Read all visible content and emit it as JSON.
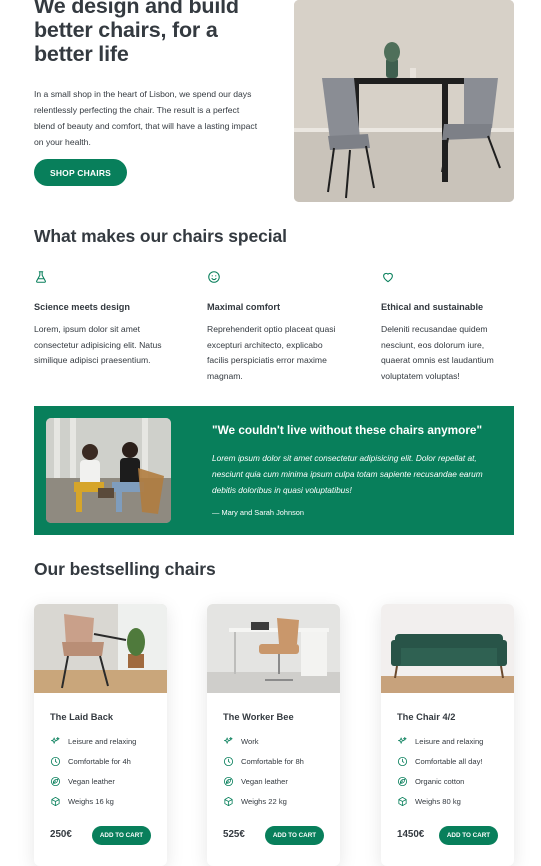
{
  "hero": {
    "title": "We design and build better chairs, for a better life",
    "text": "In a small shop in the heart of Lisbon, we spend our days relentlessly perfecting the chair. The result is a perfect blend of beauty and comfort, that will have a lasting impact on your health.",
    "button": "SHOP CHAIRS"
  },
  "features": {
    "title": "What makes our chairs special",
    "items": [
      {
        "icon": "flask-icon",
        "title": "Science meets design",
        "text": "Lorem, ipsum dolor sit amet consectetur adipisicing elit. Natus similique adipisci praesentium."
      },
      {
        "icon": "smiley-icon",
        "title": "Maximal comfort",
        "text": "Reprehenderit optio placeat quasi excepturi architecto, explicabo facilis perspiciatis error maxime magnam."
      },
      {
        "icon": "heart-icon",
        "title": "Ethical and sustainable",
        "text": "Deleniti recusandae quidem nesciunt, eos dolorum iure, quaerat omnis est laudantium voluptatem voluptas!"
      }
    ]
  },
  "testimonial": {
    "quote": "\"We couldn't live without these chairs anymore\"",
    "text": "Lorem ipsum dolor sit amet consectetur adipisicing elit. Dolor repellat at, nesciunt quia cum minima ipsum culpa totam sapiente recusandae earum debitis doloribus in quasi voluptatibus!",
    "author": "— Mary and Sarah Johnson"
  },
  "products": {
    "title": "Our bestselling chairs",
    "items": [
      {
        "name": "The Laid Back",
        "attrs": [
          "Leisure and relaxing",
          "Comfortable for 4h",
          "Vegan leather",
          "Weighs 16 kg"
        ],
        "price": "250€",
        "button": "ADD TO CART"
      },
      {
        "name": "The Worker Bee",
        "attrs": [
          "Work",
          "Comfortable for 8h",
          "Vegan leather",
          "Weighs 22 kg"
        ],
        "price": "525€",
        "button": "ADD TO CART"
      },
      {
        "name": "The Chair 4/2",
        "attrs": [
          "Leisure and relaxing",
          "Comfortable all day!",
          "Organic cotton",
          "Weighs 80 kg"
        ],
        "price": "1450€",
        "button": "ADD TO CART"
      }
    ]
  },
  "colors": {
    "primary": "#087f5b",
    "text": "#343a40"
  }
}
